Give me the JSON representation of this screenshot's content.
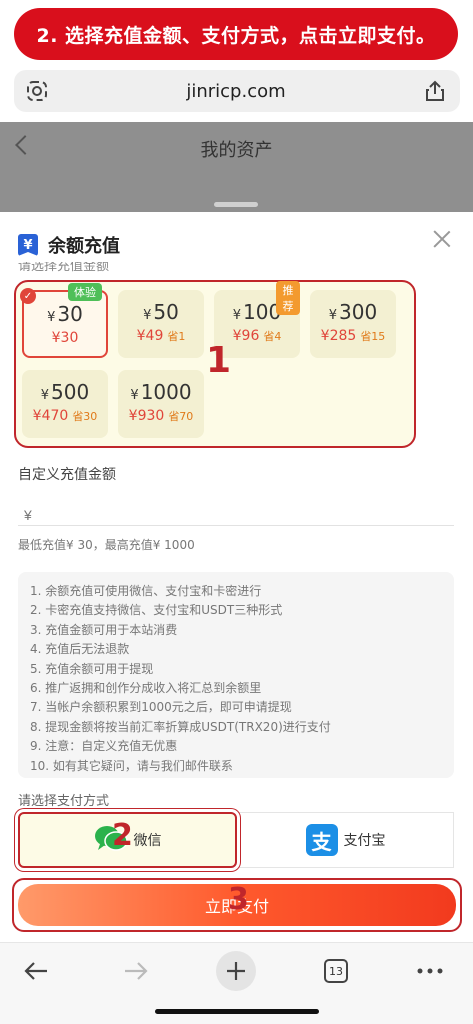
{
  "banner": {
    "text": "2. 选择充值金额、支付方式，点击立即支付。"
  },
  "browser": {
    "url": "jinricp.com",
    "tabs_count": "13"
  },
  "page": {
    "title": "我的资产"
  },
  "modal": {
    "title": "余额充值",
    "badge_icon": "¥",
    "section_label": "请选择充值金额",
    "amounts": [
      {
        "currency": "¥",
        "amount": "30",
        "price": "¥30",
        "save": "",
        "tag": "体验",
        "selected": true
      },
      {
        "currency": "¥",
        "amount": "50",
        "price": "¥49",
        "save": "省1",
        "tag": "",
        "selected": false
      },
      {
        "currency": "¥",
        "amount": "100",
        "price": "¥96",
        "save": "省4",
        "tag": "推荐",
        "selected": false
      },
      {
        "currency": "¥",
        "amount": "300",
        "price": "¥285",
        "save": "省15",
        "tag": "",
        "selected": false
      },
      {
        "currency": "¥",
        "amount": "500",
        "price": "¥470",
        "save": "省30",
        "tag": "",
        "selected": false
      },
      {
        "currency": "¥",
        "amount": "1000",
        "price": "¥930",
        "save": "省70",
        "tag": "",
        "selected": false
      }
    ],
    "custom_label": "自定义充值金额",
    "custom_placeholder": "¥",
    "range_text": "最低充值¥ 30，最高充值¥ 1000",
    "notes": [
      "1. 余额充值可使用微信、支付宝和卡密进行",
      "2. 卡密充值支持微信、支付宝和USDT三种形式",
      "3. 充值金额可用于本站消费",
      "4. 充值后无法退款",
      "5. 充值余额可用于提现",
      "6. 推广返拥和创作分成收入将汇总到余额里",
      "7. 当帐户余额积累到1000元之后，即可申请提现",
      "8. 提现金额将按当前汇率折算成USDT(TRX20)进行支付",
      "9. 注意：自定义充值无优惠",
      "10. 如有其它疑问，请与我们邮件联系"
    ],
    "pay_label": "请选择支付方式",
    "pay_methods": [
      {
        "label": "微信",
        "icon": "wechat-icon",
        "selected": true
      },
      {
        "label": "支付宝",
        "icon": "alipay-icon",
        "selected": false
      }
    ],
    "pay_button": "立即支付"
  },
  "step_markers": [
    "1",
    "2",
    "3"
  ],
  "colors": {
    "accent": "#c0262b",
    "price": "#e0453a",
    "wechat": "#2bb24c",
    "alipay": "#1c8fe6"
  }
}
